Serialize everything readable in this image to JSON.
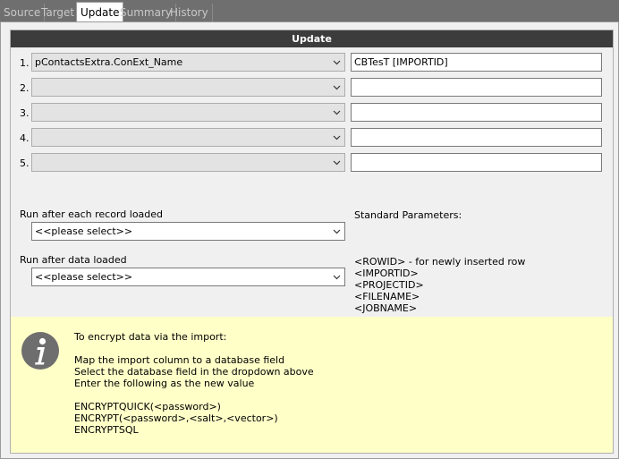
{
  "tabs": [
    {
      "label": "Source",
      "active": false
    },
    {
      "label": "Target",
      "active": false
    },
    {
      "label": "Update",
      "active": true
    },
    {
      "label": "Summary",
      "active": false
    },
    {
      "label": "History",
      "active": false
    }
  ],
  "group": {
    "title": "Update"
  },
  "updates": [
    {
      "num": "1.",
      "field": "pContactsExtra.ConExt_Name",
      "value": "CBTesT [IMPORTID]"
    },
    {
      "num": "2.",
      "field": "",
      "value": ""
    },
    {
      "num": "3.",
      "field": "",
      "value": ""
    },
    {
      "num": "4.",
      "field": "",
      "value": ""
    },
    {
      "num": "5.",
      "field": "",
      "value": ""
    }
  ],
  "run_after_record": {
    "label": "Run after each record loaded",
    "value": "<<please select>>"
  },
  "run_after_data": {
    "label": "Run after data loaded",
    "value": "<<please select>>"
  },
  "standard_params": {
    "title": "Standard Parameters:",
    "items": [
      "<ROWID>  - for newly inserted row",
      "<IMPORTID>",
      "<PROJECTID>",
      "<FILENAME>",
      "<JOBNAME>"
    ]
  },
  "info": {
    "icon": "info-icon",
    "lines": [
      "To encrypt data via the import:",
      "",
      "Map the import column to a database field",
      "Select the database field in the dropdown above",
      "Enter the following as the new value",
      "",
      "ENCRYPTQUICK(<password>)",
      "ENCRYPT(<password>,<salt>,<vector>)",
      "ENCRYPTSQL"
    ]
  },
  "colors": {
    "header_bg": "#3c3c3c",
    "info_bg": "#ffffc8",
    "chrome_bg": "#6f6f6f"
  }
}
